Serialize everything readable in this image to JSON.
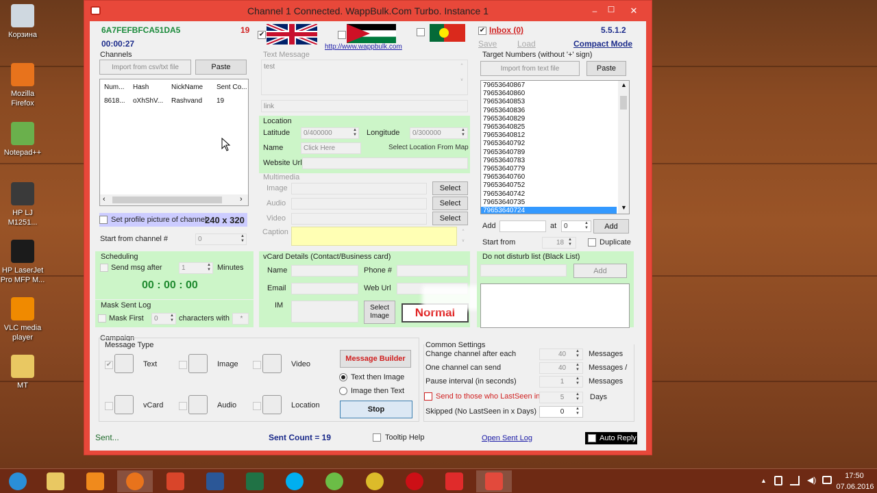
{
  "desktop": {
    "icons": [
      {
        "label": "Корзина",
        "icon": "recycle-bin-icon",
        "color": "#cfd8e0"
      },
      {
        "label": "Mozilla\nFirefox",
        "icon": "firefox-icon",
        "color": "#e8731c"
      },
      {
        "label": "Notepad++",
        "icon": "notepad-icon",
        "color": "#6ab04c"
      },
      {
        "label": "HP LJ\nM1251...",
        "icon": "printer-icon",
        "color": "#3a3a3a"
      },
      {
        "label": "HP LaserJet\nPro MFP M...",
        "icon": "hp-logo-icon",
        "color": "#1b1b1b"
      },
      {
        "label": "VLC media\nplayer",
        "icon": "vlc-icon",
        "color": "#f08a00"
      },
      {
        "label": "MT",
        "icon": "folder-icon",
        "color": "#e9c862"
      }
    ]
  },
  "window": {
    "title": "Channel 1 Connected. WappBulk.Com Turbo. Instance 1",
    "controls": {
      "minimize": "–",
      "maximize": "☐",
      "close": "✕"
    }
  },
  "header": {
    "instance_id": "6A7FEFBFCA51DA5",
    "counter": "19",
    "timer": "00:00:27",
    "url": "http://www.wappbulk.com",
    "inbox": "Inbox (0)",
    "version": "5.5.1.2",
    "save": "Save",
    "load": "Load",
    "compact_mode": "Compact Mode"
  },
  "channels": {
    "title": "Channels",
    "import_label": "Import from csv/txt file",
    "paste_label": "Paste",
    "columns": [
      "Num...",
      "Hash",
      "NickName",
      "Sent Co..."
    ],
    "rows": [
      [
        "8618...",
        "oXhShV...",
        "Rashvand",
        "19"
      ]
    ],
    "profile_pic_label": "Set profile picture of channel",
    "profile_size": "240 x 320",
    "start_from_label": "Start from channel #",
    "start_from_value": "0"
  },
  "scheduling": {
    "title": "Scheduling",
    "send_after_label": "Send msg after",
    "send_after_value": "1",
    "minutes_label": "Minutes",
    "clock": "00 : 00 : 00"
  },
  "mask": {
    "title": "Mask Sent Log",
    "mask_first_label": "Mask First",
    "mask_first_value": "0",
    "chars_with_label": "characters with",
    "mask_char": "*"
  },
  "message": {
    "title": "Text Message",
    "text": "test",
    "link_placeholder": "link",
    "location_title": "Location",
    "latitude_label": "Latitude",
    "latitude_value": "0/400000",
    "longitude_label": "Longitude",
    "longitude_value": "0/300000",
    "name_label": "Name",
    "name_value": "Click Here",
    "select_map": "Select Location From Map",
    "website_label": "Website Url",
    "multimedia_title": "Multimedia",
    "image_label": "Image",
    "audio_label": "Audio",
    "video_label": "Video",
    "caption_label": "Caption",
    "select_label": "Select"
  },
  "vcard": {
    "title": "vCard Details (Contact/Business card)",
    "name_label": "Name",
    "phone_label": "Phone #",
    "email_label": "Email",
    "weburl_label": "Web Url",
    "im_label": "IM",
    "select_image": "Select\nImage",
    "normal": "Normal"
  },
  "targets": {
    "title": "Target Numbers (without '+' sign)",
    "import_label": "Import from text file",
    "paste_label": "Paste",
    "numbers": [
      "79653640867",
      "79653640860",
      "79653640853",
      "79653640836",
      "79653640829",
      "79653640825",
      "79653640812",
      "79653640792",
      "79653640789",
      "79653640783",
      "79653640779",
      "79653640760",
      "79653640752",
      "79653640742",
      "79653640735",
      "79653640724"
    ],
    "selected_index": 15,
    "add_label": "Add",
    "at_label": "at",
    "at_value": "0",
    "add_button": "Add",
    "start_from_label": "Start from",
    "start_from_value": "18",
    "duplicate_label": "Duplicate",
    "dnd_title": "Do not disturb list (Black List)",
    "dnd_add": "Add"
  },
  "campaign": {
    "title": "Campaign",
    "message_type": "Message Type",
    "types": [
      {
        "label": "Text",
        "icon": "speech-bubble-icon",
        "checked": true
      },
      {
        "label": "Image",
        "icon": "image-icon",
        "checked": false
      },
      {
        "label": "Video",
        "icon": "clapperboard-icon",
        "checked": false
      },
      {
        "label": "vCard",
        "icon": "contact-card-icon",
        "checked": false
      },
      {
        "label": "Audio",
        "icon": "speaker-icon",
        "checked": false
      },
      {
        "label": "Location",
        "icon": "map-pin-icon",
        "checked": false
      }
    ],
    "message_builder": "Message Builder",
    "text_then_image": "Text then Image",
    "image_then_text": "Image then Text",
    "stop": "Stop"
  },
  "common": {
    "title": "Common Settings",
    "change_channel_label": "Change channel after each",
    "change_channel_value": "40",
    "change_channel_unit": "Messages",
    "one_channel_label": "One channel can send",
    "one_channel_value": "40",
    "one_channel_unit": "Messages /",
    "pause_label": "Pause interval (in seconds)",
    "pause_value": "1",
    "pause_unit": "Messages",
    "lastseen_label": "Send to those who LastSeen in",
    "lastseen_value": "5",
    "lastseen_unit": "Days",
    "skipped_label": "Skipped (No LastSeen in x Days)",
    "skipped_value": "0"
  },
  "status": {
    "sent": "Sent...",
    "sent_count": "Sent Count = 19",
    "tooltip_help": "Tooltip Help",
    "open_log": "Open Sent Log",
    "auto_reply": "Auto Reply"
  },
  "taskbar": {
    "apps": [
      {
        "name": "start-button",
        "color": "#2a8fd8"
      },
      {
        "name": "explorer",
        "color": "#e9c862"
      },
      {
        "name": "media-player",
        "color": "#f08a1c"
      },
      {
        "name": "firefox",
        "color": "#e8731c"
      },
      {
        "name": "tool",
        "color": "#d9452a"
      },
      {
        "name": "word",
        "color": "#2b5797"
      },
      {
        "name": "excel",
        "color": "#207245"
      },
      {
        "name": "skype",
        "color": "#00aff0"
      },
      {
        "name": "utorrent",
        "color": "#6bbd46"
      },
      {
        "name": "chrome",
        "color": "#dcbb2a"
      },
      {
        "name": "opera",
        "color": "#cc0f16"
      },
      {
        "name": "yandex",
        "color": "#e02b2b"
      },
      {
        "name": "wappbulk",
        "color": "#e24a3c"
      }
    ],
    "time": "17:50",
    "date": "07.06.2016"
  },
  "colors": {
    "accent": "#e8483a",
    "panel_green": "#ccf5c8",
    "title_blue": "#1a2a8a",
    "selected": "#3399ff"
  }
}
